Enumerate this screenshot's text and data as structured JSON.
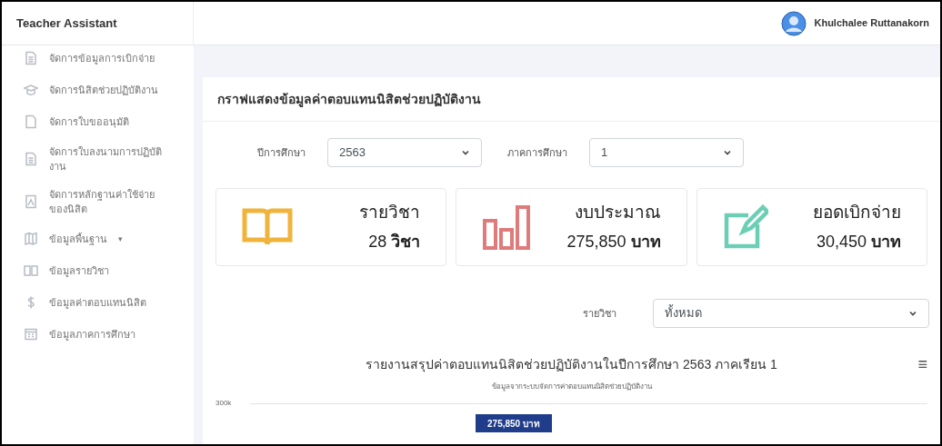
{
  "app": {
    "title": "Teacher Assistant"
  },
  "user": {
    "name": "Khulchalee Ruttanakorn"
  },
  "sidebar": {
    "items": [
      {
        "label": "จัดการข้อมูลการเบิกจ่าย",
        "kind": "doc"
      },
      {
        "label": "จัดการนิสิตช่วยปฏิบัติงาน",
        "kind": "cap"
      },
      {
        "label": "จัดการใบขออนุมัติ",
        "kind": "file"
      },
      {
        "label": "จัดการใบลงนามการปฏิบัติงาน",
        "kind": "doc"
      },
      {
        "label": "จัดการหลักฐานค่าใช้จ่ายของนิสิต",
        "kind": "pdf"
      },
      {
        "label": "ข้อมูลพื้นฐาน",
        "kind": "map",
        "caret": "▾"
      },
      {
        "label": "ข้อมูลรายวิชา",
        "kind": "book"
      },
      {
        "label": "ข้อมูลค่าตอบแทนนิสิต",
        "kind": "dollar"
      },
      {
        "label": "ข้อมูลภาคการศึกษา",
        "kind": "calendar"
      }
    ]
  },
  "panel": {
    "title": "กราฟแสดงข้อมูลค่าตอบแทนนิสิตช่วยปฏิบัติงาน",
    "filters": [
      {
        "label": "ปีการศึกษา",
        "value": "2563"
      },
      {
        "label": "ภาคการศึกษา",
        "value": "1"
      }
    ],
    "stats": [
      {
        "kind": "book",
        "label": "รายวิชา",
        "value": "28",
        "unit": "วิชา"
      },
      {
        "kind": "bars",
        "label": "งบประมาณ",
        "value": "275,850",
        "unit": "บาท"
      },
      {
        "kind": "edit",
        "label": "ยอดเบิกจ่าย",
        "value": "30,450",
        "unit": "บาท"
      }
    ],
    "course_filter": {
      "label": "รายวิชา",
      "value": "ทั้งหมด"
    },
    "chart": {
      "title": "รายงานสรุปค่าตอบแทนนิสิตช่วยปฏิบัติงานในปีการศึกษา 2563 ภาคเรียน 1",
      "subtitle": "ข้อมูลจากระบบจัดการค่าตอบแทนนิสิตช่วยปฏิบัติงาน",
      "menu": "≡",
      "y_tick": "300k",
      "bar_label": "275,850 บาท"
    }
  }
}
